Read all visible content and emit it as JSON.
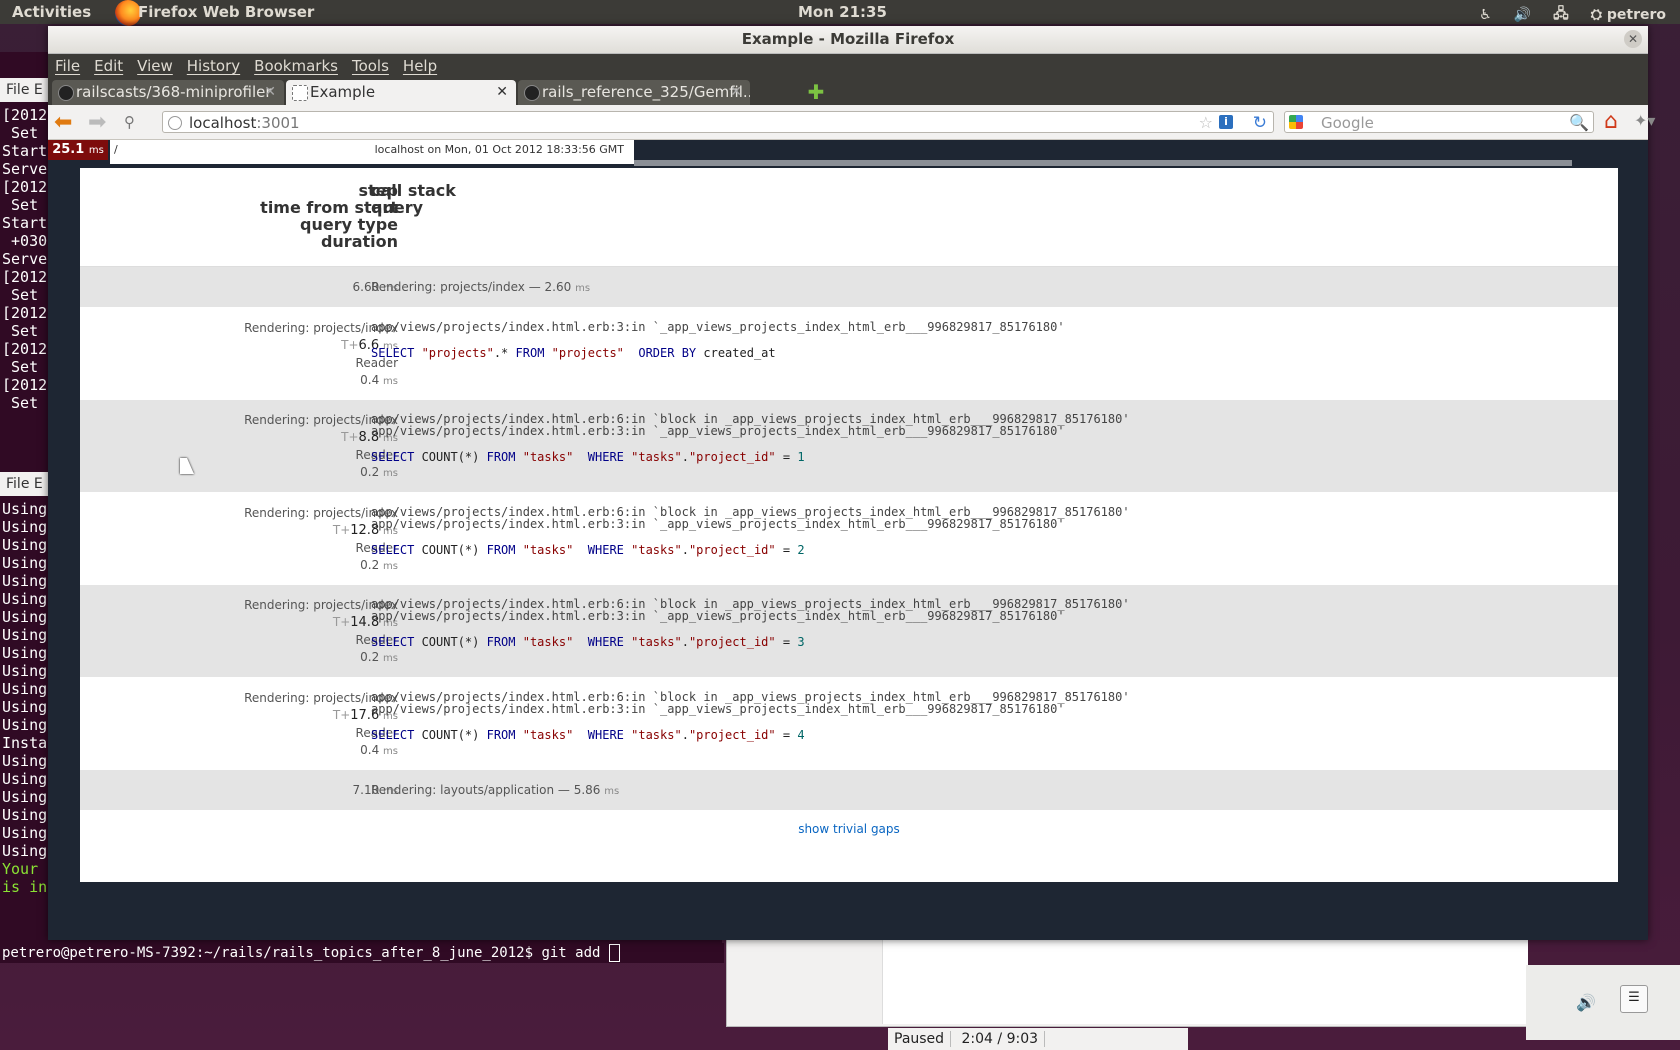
{
  "topbar": {
    "activities": "Activities",
    "app_name": "Firefox Web Browser",
    "clock": "Mon 21:35",
    "user": "petrero"
  },
  "terminal": {
    "menu_label_top": "File  E",
    "menu_label_bottom": "File  E",
    "lines_top": [
      "[2012",
      " Set",
      "",
      "Start",
      "Serve",
      "[2012",
      " Set",
      "",
      "Start",
      " +030",
      "Serve",
      "[2012",
      " Set",
      "[2012",
      " Set",
      "[2012",
      " Set",
      "[2012",
      " Set"
    ],
    "lines_bottom": [
      "Using",
      "Using",
      "Using",
      "Using",
      "Using",
      "Using",
      "Using",
      "Using",
      "Using",
      "Using",
      "Using",
      "Using",
      "Using",
      "Insta",
      "Using",
      "Using",
      "Using",
      "Using",
      "Using",
      "Using",
      "Your",
      "is in"
    ],
    "prompt": "petrero@petrero-MS-7392:~/rails/rails_topics_after_8_june_2012$ git add "
  },
  "video": {
    "status": "Paused",
    "time": "2:04 / 9:03"
  },
  "window": {
    "title": "Example - Mozilla Firefox"
  },
  "menu": [
    "File",
    "Edit",
    "View",
    "History",
    "Bookmarks",
    "Tools",
    "Help"
  ],
  "tabs": [
    {
      "label": "railscasts/368-miniprofiler",
      "active": false
    },
    {
      "label": "Example",
      "active": true
    },
    {
      "label": "rails_reference_325/Gemfil...",
      "active": false
    }
  ],
  "navbar": {
    "url_host": "localhost",
    "url_port": ":3001",
    "search_placeholder": "Google"
  },
  "profiler": {
    "badge_value": "25.1",
    "badge_unit": "ms",
    "path": "/",
    "timestamp": "localhost on Mon, 01 Oct 2012 18:33:56 GMT",
    "header_left": [
      "step",
      "time from start",
      "query type",
      "duration"
    ],
    "header_right": [
      "call stack",
      "query"
    ],
    "summary_top": {
      "duration": "6.60",
      "unit": "ms",
      "text": "Rendering: projects/index — 2.60",
      "text_unit": "ms"
    },
    "summary_bottom": {
      "duration": "7.10",
      "unit": "ms",
      "text": "Rendering: layouts/application — 5.86",
      "text_unit": "ms"
    },
    "queries": [
      {
        "step": "Rendering: projects/index",
        "t_prefix": "T+",
        "t": "6.6",
        "type": "Reader",
        "duration": "0.4",
        "stack": [
          "app/views/projects/index.html.erb:3:in `_app_views_projects_index_html_erb___996829817_85176180'"
        ],
        "sql_parts": [
          {
            "c": "kw",
            "t": "SELECT "
          },
          {
            "c": "str",
            "t": "\"projects\""
          },
          {
            "c": "",
            "t": ".* "
          },
          {
            "c": "kw",
            "t": "FROM "
          },
          {
            "c": "str",
            "t": "\"projects\""
          },
          {
            "c": "",
            "t": "  "
          },
          {
            "c": "kw",
            "t": "ORDER BY "
          },
          {
            "c": "",
            "t": "created_at"
          }
        ]
      },
      {
        "step": "Rendering: projects/index",
        "t_prefix": "T+",
        "t": "8.8",
        "type": "Reader",
        "duration": "0.2",
        "stack": [
          "app/views/projects/index.html.erb:6:in `block in _app_views_projects_index_html_erb___996829817_85176180'",
          "app/views/projects/index.html.erb:3:in `_app_views_projects_index_html_erb___996829817_85176180'"
        ],
        "sql_parts": [
          {
            "c": "kw",
            "t": "SELECT "
          },
          {
            "c": "",
            "t": "COUNT(*) "
          },
          {
            "c": "kw",
            "t": "FROM "
          },
          {
            "c": "str",
            "t": "\"tasks\""
          },
          {
            "c": "",
            "t": "  "
          },
          {
            "c": "kw",
            "t": "WHERE "
          },
          {
            "c": "str",
            "t": "\"tasks\""
          },
          {
            "c": "",
            "t": "."
          },
          {
            "c": "str",
            "t": "\"project_id\""
          },
          {
            "c": "",
            "t": " = "
          },
          {
            "c": "num",
            "t": "1"
          }
        ]
      },
      {
        "step": "Rendering: projects/index",
        "t_prefix": "T+",
        "t": "12.8",
        "type": "Reader",
        "duration": "0.2",
        "stack": [
          "app/views/projects/index.html.erb:6:in `block in _app_views_projects_index_html_erb___996829817_85176180'",
          "app/views/projects/index.html.erb:3:in `_app_views_projects_index_html_erb___996829817_85176180'"
        ],
        "sql_parts": [
          {
            "c": "kw",
            "t": "SELECT "
          },
          {
            "c": "",
            "t": "COUNT(*) "
          },
          {
            "c": "kw",
            "t": "FROM "
          },
          {
            "c": "str",
            "t": "\"tasks\""
          },
          {
            "c": "",
            "t": "  "
          },
          {
            "c": "kw",
            "t": "WHERE "
          },
          {
            "c": "str",
            "t": "\"tasks\""
          },
          {
            "c": "",
            "t": "."
          },
          {
            "c": "str",
            "t": "\"project_id\""
          },
          {
            "c": "",
            "t": " = "
          },
          {
            "c": "num",
            "t": "2"
          }
        ]
      },
      {
        "step": "Rendering: projects/index",
        "t_prefix": "T+",
        "t": "14.8",
        "type": "Reader",
        "duration": "0.2",
        "stack": [
          "app/views/projects/index.html.erb:6:in `block in _app_views_projects_index_html_erb___996829817_85176180'",
          "app/views/projects/index.html.erb:3:in `_app_views_projects_index_html_erb___996829817_85176180'"
        ],
        "sql_parts": [
          {
            "c": "kw",
            "t": "SELECT "
          },
          {
            "c": "",
            "t": "COUNT(*) "
          },
          {
            "c": "kw",
            "t": "FROM "
          },
          {
            "c": "str",
            "t": "\"tasks\""
          },
          {
            "c": "",
            "t": "  "
          },
          {
            "c": "kw",
            "t": "WHERE "
          },
          {
            "c": "str",
            "t": "\"tasks\""
          },
          {
            "c": "",
            "t": "."
          },
          {
            "c": "str",
            "t": "\"project_id\""
          },
          {
            "c": "",
            "t": " = "
          },
          {
            "c": "num",
            "t": "3"
          }
        ]
      },
      {
        "step": "Rendering: projects/index",
        "t_prefix": "T+",
        "t": "17.6",
        "type": "Reader",
        "duration": "0.4",
        "stack": [
          "app/views/projects/index.html.erb:6:in `block in _app_views_projects_index_html_erb___996829817_85176180'",
          "app/views/projects/index.html.erb:3:in `_app_views_projects_index_html_erb___996829817_85176180'"
        ],
        "sql_parts": [
          {
            "c": "kw",
            "t": "SELECT "
          },
          {
            "c": "",
            "t": "COUNT(*) "
          },
          {
            "c": "kw",
            "t": "FROM "
          },
          {
            "c": "str",
            "t": "\"tasks\""
          },
          {
            "c": "",
            "t": "  "
          },
          {
            "c": "kw",
            "t": "WHERE "
          },
          {
            "c": "str",
            "t": "\"tasks\""
          },
          {
            "c": "",
            "t": "."
          },
          {
            "c": "str",
            "t": "\"project_id\""
          },
          {
            "c": "",
            "t": " = "
          },
          {
            "c": "num",
            "t": "4"
          }
        ]
      }
    ],
    "unit": "ms",
    "show_trivial_label": "show trivial gaps"
  }
}
